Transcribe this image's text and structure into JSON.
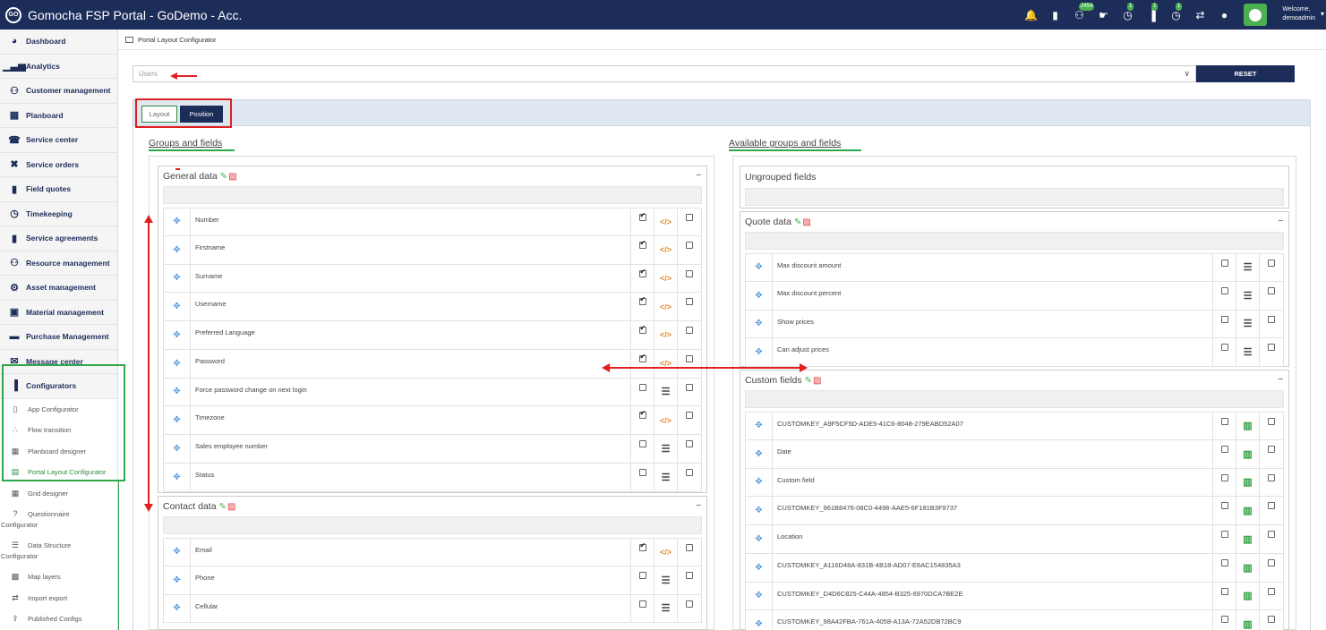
{
  "header": {
    "logo_text": "GO",
    "title": "Gomocha FSP Portal - GoDemo - Acc.",
    "icons": [
      {
        "name": "bell-icon",
        "glyph": "🔔",
        "badge": ""
      },
      {
        "name": "document-icon",
        "glyph": "▮",
        "badge": ""
      },
      {
        "name": "users-icon",
        "glyph": "⚇",
        "badge": "2454"
      },
      {
        "name": "thumbs-down-icon",
        "glyph": "☛",
        "badge": ""
      },
      {
        "name": "clock-icon",
        "glyph": "◷",
        "badge": "1"
      },
      {
        "name": "chart-icon",
        "glyph": "▐",
        "badge": "1"
      },
      {
        "name": "clock-check-icon",
        "glyph": "◷",
        "badge": "1"
      },
      {
        "name": "transfer-icon",
        "glyph": "⇄",
        "badge": ""
      },
      {
        "name": "chat-icon",
        "glyph": "●",
        "badge": ""
      }
    ],
    "welcome_line1": "Welcome,",
    "welcome_line2": "demoadmin"
  },
  "sidebar": {
    "items": [
      {
        "name": "dashboard",
        "label": "Dashboard",
        "icon": "dashboard-icon",
        "glyph": "◕"
      },
      {
        "name": "analytics",
        "label": "Analytics",
        "icon": "analytics-icon",
        "glyph": "▁▃▅"
      },
      {
        "name": "customer-management",
        "label": "Customer management",
        "icon": "customers-icon",
        "glyph": "⚇"
      },
      {
        "name": "planboard",
        "label": "Planboard",
        "icon": "calendar-icon",
        "glyph": "▦"
      },
      {
        "name": "service-center",
        "label": "Service center",
        "icon": "phone-icon",
        "glyph": "☎"
      },
      {
        "name": "service-orders",
        "label": "Service orders",
        "icon": "tools-icon",
        "glyph": "✖"
      },
      {
        "name": "field-quotes",
        "label": "Field quotes",
        "icon": "quote-icon",
        "glyph": "▮"
      },
      {
        "name": "timekeeping",
        "label": "Timekeeping",
        "icon": "clock-icon",
        "glyph": "◷"
      },
      {
        "name": "service-agreements",
        "label": "Service agreements",
        "icon": "agreement-icon",
        "glyph": "▮"
      },
      {
        "name": "resource-management",
        "label": "Resource management",
        "icon": "resources-icon",
        "glyph": "⚇"
      },
      {
        "name": "asset-management",
        "label": "Asset management",
        "icon": "asset-icon",
        "glyph": "⚙"
      },
      {
        "name": "material-management",
        "label": "Material management",
        "icon": "material-icon",
        "glyph": "▣"
      },
      {
        "name": "purchase-management",
        "label": "Purchase Management",
        "icon": "purchase-icon",
        "glyph": "▬"
      },
      {
        "name": "message-center",
        "label": "Message center",
        "icon": "envelope-icon",
        "glyph": "✉"
      },
      {
        "name": "configurators",
        "label": "Configurators",
        "icon": "factory-icon",
        "glyph": "▐"
      }
    ],
    "sub_items": [
      {
        "name": "app-configurator",
        "label": "App Configurator",
        "icon": "mobile-icon",
        "glyph": "▯",
        "two_line": false,
        "active": false
      },
      {
        "name": "flow-transition",
        "label": "Flow transition",
        "icon": "flow-icon",
        "glyph": "∴",
        "two_line": false,
        "active": false
      },
      {
        "name": "planboard-designer",
        "label": "Planboard designer",
        "icon": "calendar-icon",
        "glyph": "▦",
        "two_line": false,
        "active": false
      },
      {
        "name": "portal-layout-configurator",
        "label": "Portal Layout Configurator",
        "icon": "layout-icon",
        "glyph": "▤",
        "two_line": false,
        "active": true
      },
      {
        "name": "grid-designer",
        "label": "Grid designer",
        "icon": "grid-icon",
        "glyph": "▦",
        "two_line": false,
        "active": false
      },
      {
        "name": "questionnaire-configurator",
        "label": "Questionnaire",
        "label2": "Configurator",
        "icon": "question-icon",
        "glyph": "?",
        "two_line": true,
        "active": false
      },
      {
        "name": "data-structure-configurator",
        "label": "Data Structure",
        "label2": "Configurator",
        "icon": "database-icon",
        "glyph": "☰",
        "two_line": true,
        "active": false
      },
      {
        "name": "map-layers",
        "label": "Map layers",
        "icon": "map-icon",
        "glyph": "▩",
        "two_line": false,
        "active": false
      },
      {
        "name": "import-export",
        "label": "Import export",
        "icon": "import-export-icon",
        "glyph": "⇄",
        "two_line": false,
        "active": false
      },
      {
        "name": "published-configs",
        "label": "Published Configs",
        "icon": "publish-icon",
        "glyph": "⇪",
        "two_line": false,
        "active": false
      }
    ]
  },
  "breadcrumb": {
    "label": "Portal Layout Configurator"
  },
  "user_select": {
    "value": "Users"
  },
  "reset_label": "RESET",
  "tabs": {
    "layout": "Layout",
    "position": "Position"
  },
  "left_title": "Groups and fields",
  "right_title": "Available groups and fields",
  "left_groups": [
    {
      "title": "General data",
      "fields": [
        {
          "label": "Number",
          "checked": true,
          "type": "code",
          "c3": false
        },
        {
          "label": "Firstname",
          "checked": true,
          "type": "code",
          "c3": false
        },
        {
          "label": "Surname",
          "checked": true,
          "type": "code",
          "c3": false
        },
        {
          "label": "Username",
          "checked": true,
          "type": "code",
          "c3": false
        },
        {
          "label": "Preferred Language",
          "checked": true,
          "type": "code",
          "c3": false
        },
        {
          "label": "Password",
          "checked": true,
          "type": "code",
          "c3": false
        },
        {
          "label": "Force password change on next login",
          "checked": false,
          "type": "list",
          "c3": false
        },
        {
          "label": "Timezone",
          "checked": true,
          "type": "code",
          "c3": false
        },
        {
          "label": "Sales employee number",
          "checked": false,
          "type": "list",
          "c3": false
        },
        {
          "label": "Status",
          "checked": false,
          "type": "list",
          "c3": false
        }
      ]
    },
    {
      "title": "Contact data",
      "fields": [
        {
          "label": "Email",
          "checked": true,
          "type": "code",
          "c3": false
        },
        {
          "label": "Phone",
          "checked": false,
          "type": "list",
          "c3": false
        },
        {
          "label": "Cellular",
          "checked": false,
          "type": "list",
          "c3": false
        }
      ]
    }
  ],
  "ungrouped": {
    "title": "Ungrouped fields"
  },
  "right_groups": [
    {
      "title": "Quote data",
      "fields": [
        {
          "label": "Max discount amount",
          "checked": false,
          "type": "list",
          "c3": false
        },
        {
          "label": "Max discount percent",
          "checked": false,
          "type": "list",
          "c3": false
        },
        {
          "label": "Show prices",
          "checked": false,
          "type": "list",
          "c3": false
        },
        {
          "label": "Can adjust prices",
          "checked": false,
          "type": "list",
          "c3": false
        }
      ]
    },
    {
      "title": "Custom fields",
      "fields": [
        {
          "label": "CUSTOMKEY_A9F5CF5D-ADE5-41C6-8048-279EABD52A07",
          "checked": false,
          "type": "grid",
          "c3": false
        },
        {
          "label": "Date",
          "checked": false,
          "type": "grid",
          "c3": false
        },
        {
          "label": "Custom field",
          "checked": false,
          "type": "grid",
          "c3": false
        },
        {
          "label": "CUSTOMKEY_961B8476-08C0-4498-AAE5-6F181B3F9737",
          "checked": false,
          "type": "grid",
          "c3": false
        },
        {
          "label": "Location",
          "checked": false,
          "type": "grid",
          "c3": false
        },
        {
          "label": "CUSTOMKEY_A116D48A-831B-4B18-AD07-E6AC154835A3",
          "checked": false,
          "type": "grid",
          "c3": false
        },
        {
          "label": "CUSTOMKEY_D4D6C825-C44A-4854-B325-6970DCA7BE2E",
          "checked": false,
          "type": "grid",
          "c3": false
        },
        {
          "label": "CUSTOMKEY_98A42FBA-761A-4058-A13A-72A52DB72BC9",
          "checked": false,
          "type": "grid",
          "c3": false
        }
      ]
    }
  ],
  "glyphs": {
    "move": "✥",
    "code": "</>",
    "list": "☰",
    "grid": "▥",
    "pencil": "✎",
    "trash": "▨",
    "minus": "–",
    "chevron_down": "∨",
    "caret_down": "▾"
  },
  "colors": {
    "navy": "#1c2d5a",
    "green": "#2ea84a",
    "annotation_red": "#e02020",
    "orange": "#e8881c"
  }
}
